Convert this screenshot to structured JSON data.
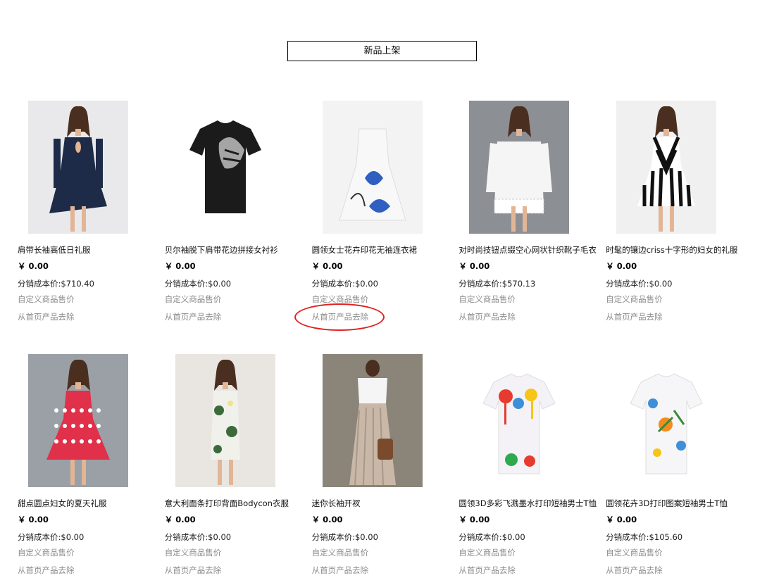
{
  "section": {
    "title": "新品上架"
  },
  "colors": {
    "link_gray": "#8c8c8c",
    "annotation_red": "#e02020"
  },
  "products": [
    {
      "name": "肩带长袖高低日礼服",
      "price": "￥ 0.00",
      "cost": "分销成本价:$710.40",
      "custom_label": "自定义商品售价",
      "remove_label": "从首页产品去除",
      "image": "navy-keyhole-dress",
      "image_bg": "#e9e9eb",
      "main": "#1e2b48",
      "accent": "#c08870"
    },
    {
      "name": "贝尔袖脱下肩带花边拼接女衬衫",
      "price": "￥ 0.00",
      "cost": "分销成本价:$0.00",
      "custom_label": "自定义商品售价",
      "remove_label": "从首页产品去除",
      "image": "black-tiger-tshirt",
      "image_bg": "#ffffff",
      "main": "#1b1b1b",
      "accent": "#bdbdbd"
    },
    {
      "name": "圆领女士花卉印花无袖连衣裙",
      "price": "￥ 0.00",
      "cost": "分销成本价:$0.00",
      "custom_label": "自定义商品售价",
      "remove_label": "从首页产品去除",
      "image": "butterfly-print-dress",
      "image_bg": "#f3f3f3",
      "main": "#f8f8f8",
      "accent": "#2f5fc0"
    },
    {
      "name": "对时尚技钮点缀空心网状针织靴子毛衣",
      "price": "￥ 0.00",
      "cost": "分销成本价:$570.13",
      "custom_label": "自定义商品售价",
      "remove_label": "从首页产品去除",
      "image": "white-lace-top",
      "image_bg": "#8c8f94",
      "main": "#f5f5f5",
      "accent": "#d9b79c"
    },
    {
      "name": "时髦的镶边criss十字形的妇女的礼服",
      "price": "￥ 0.00",
      "cost": "分销成本价:$0.00",
      "custom_label": "自定义商品售价",
      "remove_label": "从首页产品去除",
      "image": "striped-dress",
      "image_bg": "#f0f0f0",
      "main": "#111111",
      "accent": "#e8c7a8"
    },
    {
      "name": "甜点圆点妇女的夏天礼服",
      "price": "￥ 0.00",
      "cost": "分销成本价:$0.00",
      "custom_label": "自定义商品售价",
      "remove_label": "从首页产品去除",
      "image": "red-polka-dress",
      "image_bg": "#9aa0a6",
      "main": "#e0304a",
      "accent": "#c9936e"
    },
    {
      "name": "意大利面条打印背面Bodycon衣服",
      "price": "￥ 0.00",
      "cost": "分销成本价:$0.00",
      "custom_label": "自定义商品售价",
      "remove_label": "从首页产品去除",
      "image": "floral-bodycon",
      "image_bg": "#e9e6e2",
      "main": "#f1f1ec",
      "accent": "#3b6b3a"
    },
    {
      "name": "迷你长袖开衩",
      "price": "￥ 0.00",
      "cost": "分销成本价:$0.00",
      "custom_label": "自定义商品售价",
      "remove_label": "从首页产品去除",
      "image": "pleated-maxi",
      "image_bg": "#8a8479",
      "main": "#c9b8a7",
      "accent": "#7a4a2c"
    },
    {
      "name": "圆领3D多彩飞溅墨水打印短袖男士T恤",
      "price": "￥ 0.00",
      "cost": "分销成本价:$0.00",
      "custom_label": "自定义商品售价",
      "remove_label": "从首页产品去除",
      "image": "splash-tshirt",
      "image_bg": "#ffffff",
      "main": "#f4f2f6",
      "accent": "#e63b2e"
    },
    {
      "name": "圆领花卉3D打印图案短袖男士T恤",
      "price": "￥ 0.00",
      "cost": "分销成本价:$105.60",
      "custom_label": "自定义商品售价",
      "remove_label": "从首页产品去除",
      "image": "floral-tshirt",
      "image_bg": "#ffffff",
      "main": "#f6f6f8",
      "accent": "#3d8fd8"
    }
  ]
}
